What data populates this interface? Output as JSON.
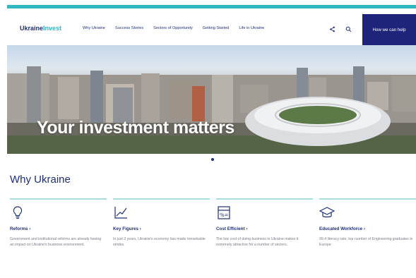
{
  "header": {
    "logo_main": "Ukraine",
    "logo_accent": "Invest",
    "nav": [
      "Why Ukraine",
      "Success Stories",
      "Sectors of Opportunity",
      "Getting Started",
      "Life in Ukraine"
    ],
    "cta_label": "How we can help"
  },
  "hero": {
    "title": "Your investment matters"
  },
  "why": {
    "title": "Why Ukraine",
    "cards": [
      {
        "title": "Reforms ›",
        "desc": "Government and institutional reforms are already having an impact on Ukraine's business environment."
      },
      {
        "title": "Key Figures ›",
        "desc": "In just 3 years, Ukraine's economy has made remarkable strides."
      },
      {
        "title": "Cost Efficient ›",
        "desc": "The low cost of doing business in Ukraine makes it extremely attractive for a number of sectors."
      },
      {
        "title": "Educated Workforce ›",
        "desc": "99.4 literacy rate, top number of Engineering graduates in Europe"
      }
    ]
  },
  "colors": {
    "navy": "#1d2479",
    "teal": "#2fb6c5",
    "card_line": "#a8dbe2"
  },
  "icons": [
    "share-icon",
    "search-icon",
    "lightbulb-icon",
    "chart-icon",
    "calculator-icon",
    "graduation-cap-icon"
  ]
}
